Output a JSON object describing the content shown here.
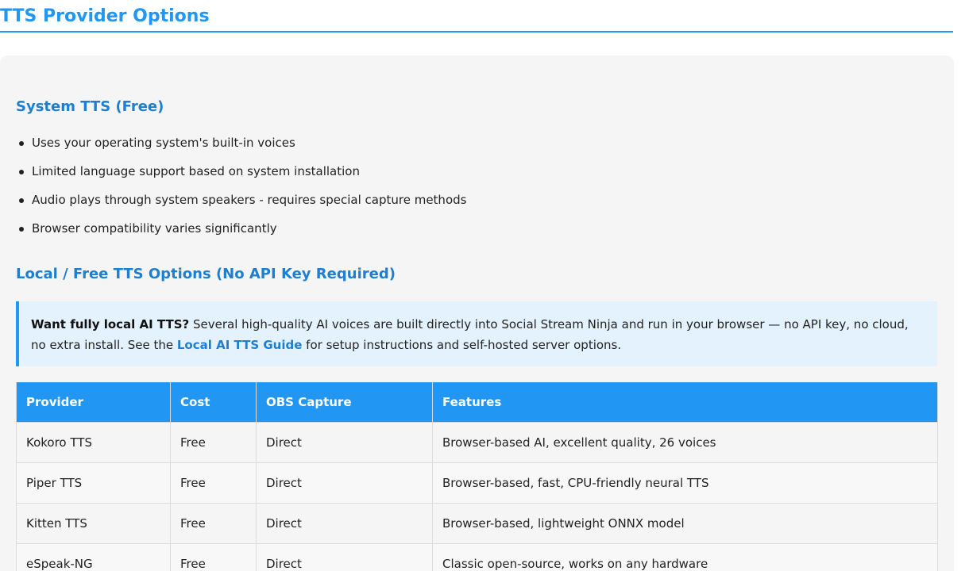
{
  "page": {
    "title": "TTS Provider Options"
  },
  "system_section": {
    "heading": "System TTS (Free)",
    "items": [
      "Uses your operating system's built-in voices",
      "Limited language support based on system installation",
      "Audio plays through system speakers - requires special capture methods",
      "Browser compatibility varies significantly"
    ]
  },
  "local_section": {
    "heading": "Local / Free TTS Options (No API Key Required)",
    "callout": {
      "strong": "Want fully local AI TTS?",
      "text_before_link": " Several high-quality AI voices are built directly into Social Stream Ninja and run in your browser — no API key, no cloud, no extra install. See the ",
      "link": "Local AI TTS Guide",
      "text_after_link": " for setup instructions and self-hosted server options."
    }
  },
  "table": {
    "headers": [
      "Provider",
      "Cost",
      "OBS Capture",
      "Features"
    ],
    "rows": [
      [
        "Kokoro TTS",
        "Free",
        "Direct",
        "Browser-based AI, excellent quality, 26 voices"
      ],
      [
        "Piper TTS",
        "Free",
        "Direct",
        "Browser-based, fast, CPU-friendly neural TTS"
      ],
      [
        "Kitten TTS",
        "Free",
        "Direct",
        "Browser-based, lightweight ONNX model"
      ],
      [
        "eSpeak-NG",
        "Free",
        "Direct",
        "Classic open-source, works on any hardware"
      ]
    ]
  },
  "colors": {
    "accent": "#2196f3",
    "heading": "#1e7fd0",
    "callout_bg": "#e3f2fd",
    "card_bg": "#f5f5f5"
  }
}
